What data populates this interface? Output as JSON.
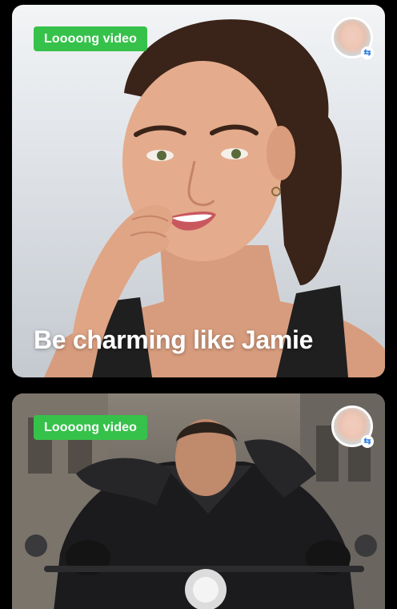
{
  "cards": [
    {
      "badge": "Loooong video",
      "caption": "Be charming like Jamie",
      "avatar_icon": "face-swap-avatar-icon",
      "swap_icon": "swap-arrows-icon"
    },
    {
      "badge": "Loooong video",
      "caption": "",
      "avatar_icon": "face-swap-avatar-icon",
      "swap_icon": "swap-arrows-icon"
    }
  ],
  "swap_glyph": "⇆"
}
